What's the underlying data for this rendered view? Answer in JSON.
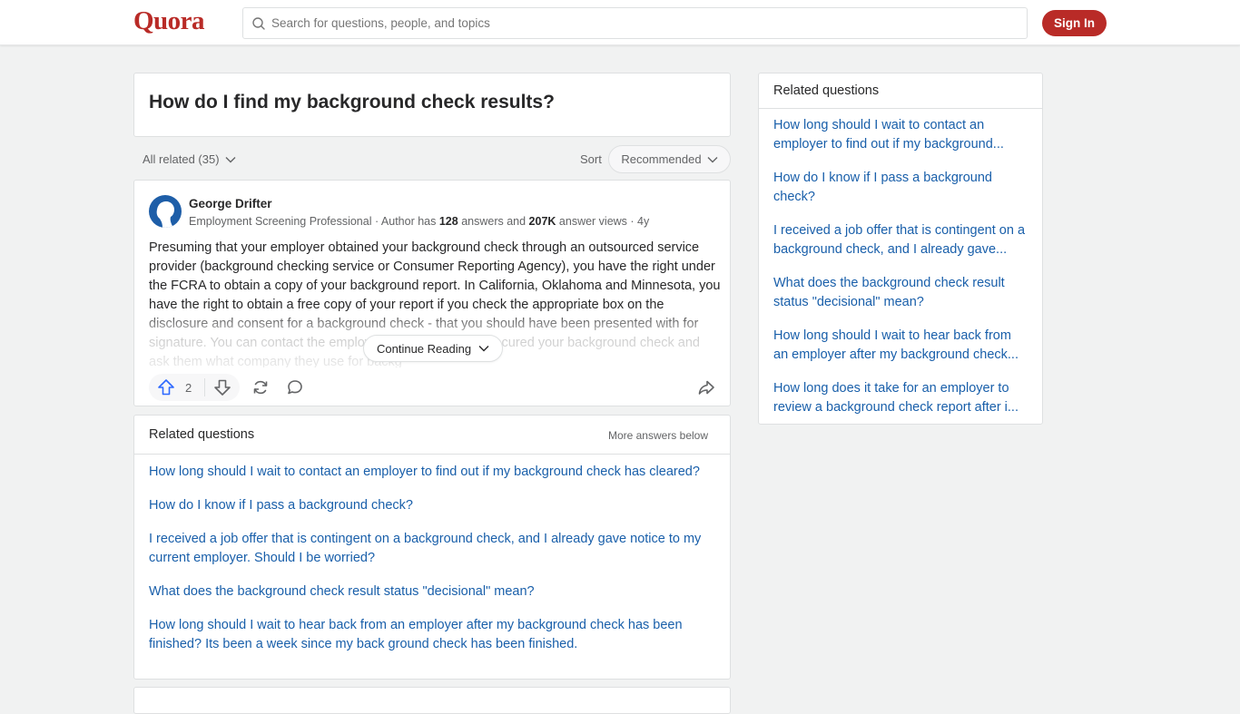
{
  "header": {
    "logo": "Quora",
    "search_placeholder": "Search for questions, people, and topics",
    "sign_in_label": "Sign In"
  },
  "question": {
    "title": "How do I find my background check results?"
  },
  "filters": {
    "all_related_label": "All related (35)",
    "sort_label": "Sort",
    "sort_value": "Recommended"
  },
  "answer": {
    "author_name": "George Drifter",
    "author_credential": "Employment Screening Professional",
    "meta_prefix": " · Author has ",
    "answers_count": "128",
    "meta_mid": " answers and ",
    "views_count": "207K",
    "meta_suffix": " answer views · 4y",
    "body": "Presuming that your employer obtained your background check through an outsourced service provider (background checking service or Consumer Reporting Agency), you have the right under the FCRA to obtain a copy of your background report. In California, Oklahoma and Minnesota, you have the right to obtain a free copy of your report if you check the appropriate box on the disclosure and consent for a background check - that you should have been presented with for signature. You can contact the employer that would have procured your background check and ask them what company they use for backg",
    "continue_reading_label": "Continue Reading",
    "upvote_count": "2"
  },
  "related_inline": {
    "title": "Related questions",
    "more_label": "More answers below",
    "items": [
      "How long should I wait to contact an employer to find out if my background check has cleared?",
      "How do I know if I pass a background check?",
      "I received a job offer that is contingent on a background check, and I already gave notice to my current employer. Should I be worried?",
      "What does the background check result status \"decisional\" mean?",
      "How long should I wait to hear back from an employer after my background check has been finished? Its been a week since my back ground check has been finished."
    ]
  },
  "sidebar": {
    "title": "Related questions",
    "items": [
      "How long should I wait to contact an employer to find out if my background...",
      "How do I know if I pass a background check?",
      "I received a job offer that is contingent on a background check, and I already gave...",
      "What does the background check result status \"decisional\" mean?",
      "How long should I wait to hear back from an employer after my background check...",
      "How long does it take for an employer to review a background check report after i..."
    ]
  },
  "colors": {
    "brand": "#b92b27",
    "link": "#195faa",
    "upvote": "#2e69ff"
  }
}
